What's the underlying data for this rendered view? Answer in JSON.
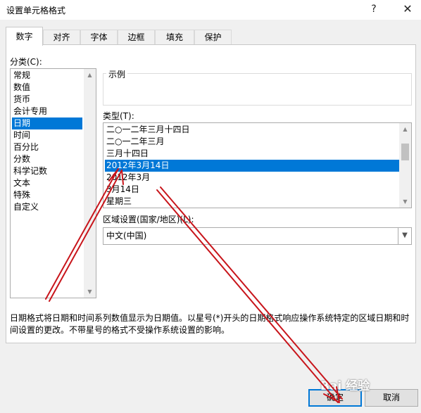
{
  "window": {
    "title": "设置单元格格式",
    "help_label": "?",
    "close_label": "✕"
  },
  "tabs": [
    {
      "label": "数字"
    },
    {
      "label": "对齐"
    },
    {
      "label": "字体"
    },
    {
      "label": "边框"
    },
    {
      "label": "填充"
    },
    {
      "label": "保护"
    }
  ],
  "category": {
    "label": "分类(C):",
    "items": [
      "常规",
      "数值",
      "货币",
      "会计专用",
      "日期",
      "时间",
      "百分比",
      "分数",
      "科学记数",
      "文本",
      "特殊",
      "自定义"
    ],
    "selected": "日期"
  },
  "sample": {
    "label": "示例"
  },
  "type": {
    "label": "类型(T):",
    "items": [
      "二○一二年三月十四日",
      "二○一二年三月",
      "三月十四日",
      "2012年3月14日",
      "2012年3月",
      "3月14日",
      "星期三"
    ],
    "selected": "2012年3月14日"
  },
  "locale": {
    "label": "区域设置(国家/地区)(L):",
    "value": "中文(中国)"
  },
  "description": "日期格式将日期和时间系列数值显示为日期值。以星号(*)开头的日期格式响应操作系统特定的区域日期和时间设置的更改。不带星号的格式不受操作系统设置的影响。",
  "buttons": {
    "ok": "确定",
    "cancel": "取消"
  },
  "watermark": "Bai 经验",
  "icons": {
    "up": "triangle-up-icon",
    "down": "triangle-down-icon"
  },
  "colors": {
    "selection": "#0078d7",
    "annotation_arrow": "#c8151b"
  }
}
